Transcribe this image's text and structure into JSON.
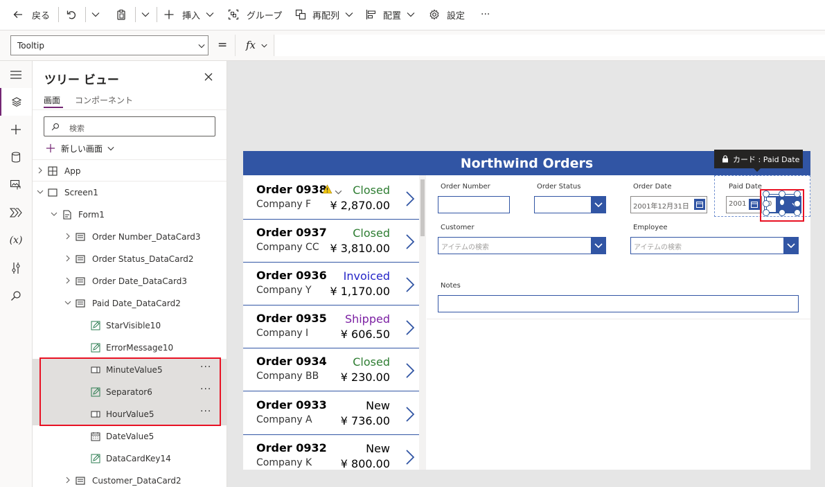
{
  "toolbar": {
    "back_label": "戻る",
    "insert_label": "挿入",
    "group_label": "グループ",
    "reorder_label": "再配列",
    "align_label": "配置",
    "settings_label": "設定",
    "more_label": "···"
  },
  "formula_bar": {
    "property": "Tooltip",
    "equals": "=",
    "fx": "fx",
    "formula": ""
  },
  "tree": {
    "title": "ツリー ビュー",
    "tabs": [
      "画面",
      "コンポーネント"
    ],
    "active_tab": 0,
    "search_placeholder": "検索",
    "new_screen_label": "新しい画面",
    "items": [
      {
        "label": "App"
      },
      {
        "label": "Screen1"
      },
      {
        "label": "Form1"
      },
      {
        "label": "Order Number_DataCard3"
      },
      {
        "label": "Order Status_DataCard2"
      },
      {
        "label": "Order Date_DataCard3"
      },
      {
        "label": "Paid Date_DataCard2"
      },
      {
        "label": "StarVisible10"
      },
      {
        "label": "ErrorMessage10"
      },
      {
        "label": "MinuteValue5",
        "more": "···"
      },
      {
        "label": "Separator6",
        "more": "···"
      },
      {
        "label": "HourValue5",
        "more": "···"
      },
      {
        "label": "DateValue5"
      },
      {
        "label": "DataCardKey14"
      },
      {
        "label": "Customer_DataCard2"
      }
    ]
  },
  "app": {
    "title": "Northwind Orders",
    "tooltip": "カード : Paid Date",
    "orders": [
      {
        "number": "Order 0938",
        "company": "Company F",
        "status": "Closed",
        "amount": "¥ 2,870.00"
      },
      {
        "number": "Order 0937",
        "company": "Company CC",
        "status": "Closed",
        "amount": "¥ 3,810.00"
      },
      {
        "number": "Order 0936",
        "company": "Company Y",
        "status": "Invoiced",
        "amount": "¥ 1,170.00"
      },
      {
        "number": "Order 0935",
        "company": "Company I",
        "status": "Shipped",
        "amount": "¥ 606.50"
      },
      {
        "number": "Order 0934",
        "company": "Company BB",
        "status": "Closed",
        "amount": "¥ 230.00"
      },
      {
        "number": "Order 0933",
        "company": "Company A",
        "status": "New",
        "amount": "¥ 736.00"
      },
      {
        "number": "Order 0932",
        "company": "Company K",
        "status": "New",
        "amount": "¥ 800.00"
      }
    ],
    "status_colors": {
      "Closed": "#2e7d32",
      "Invoiced": "#2525c8",
      "Shipped": "#7b1fa2",
      "New": "#000000"
    },
    "form": {
      "order_number_label": "Order Number",
      "order_status_label": "Order Status",
      "order_date_label": "Order Date",
      "order_date_value": "2001年12月31日",
      "paid_date_label": "Paid Date",
      "paid_date_value": "2001",
      "paid_hour_value": "0",
      "customer_label": "Customer",
      "customer_placeholder": "アイテムの検索",
      "employee_label": "Employee",
      "employee_placeholder": "アイテムの検索",
      "notes_label": "Notes"
    }
  }
}
